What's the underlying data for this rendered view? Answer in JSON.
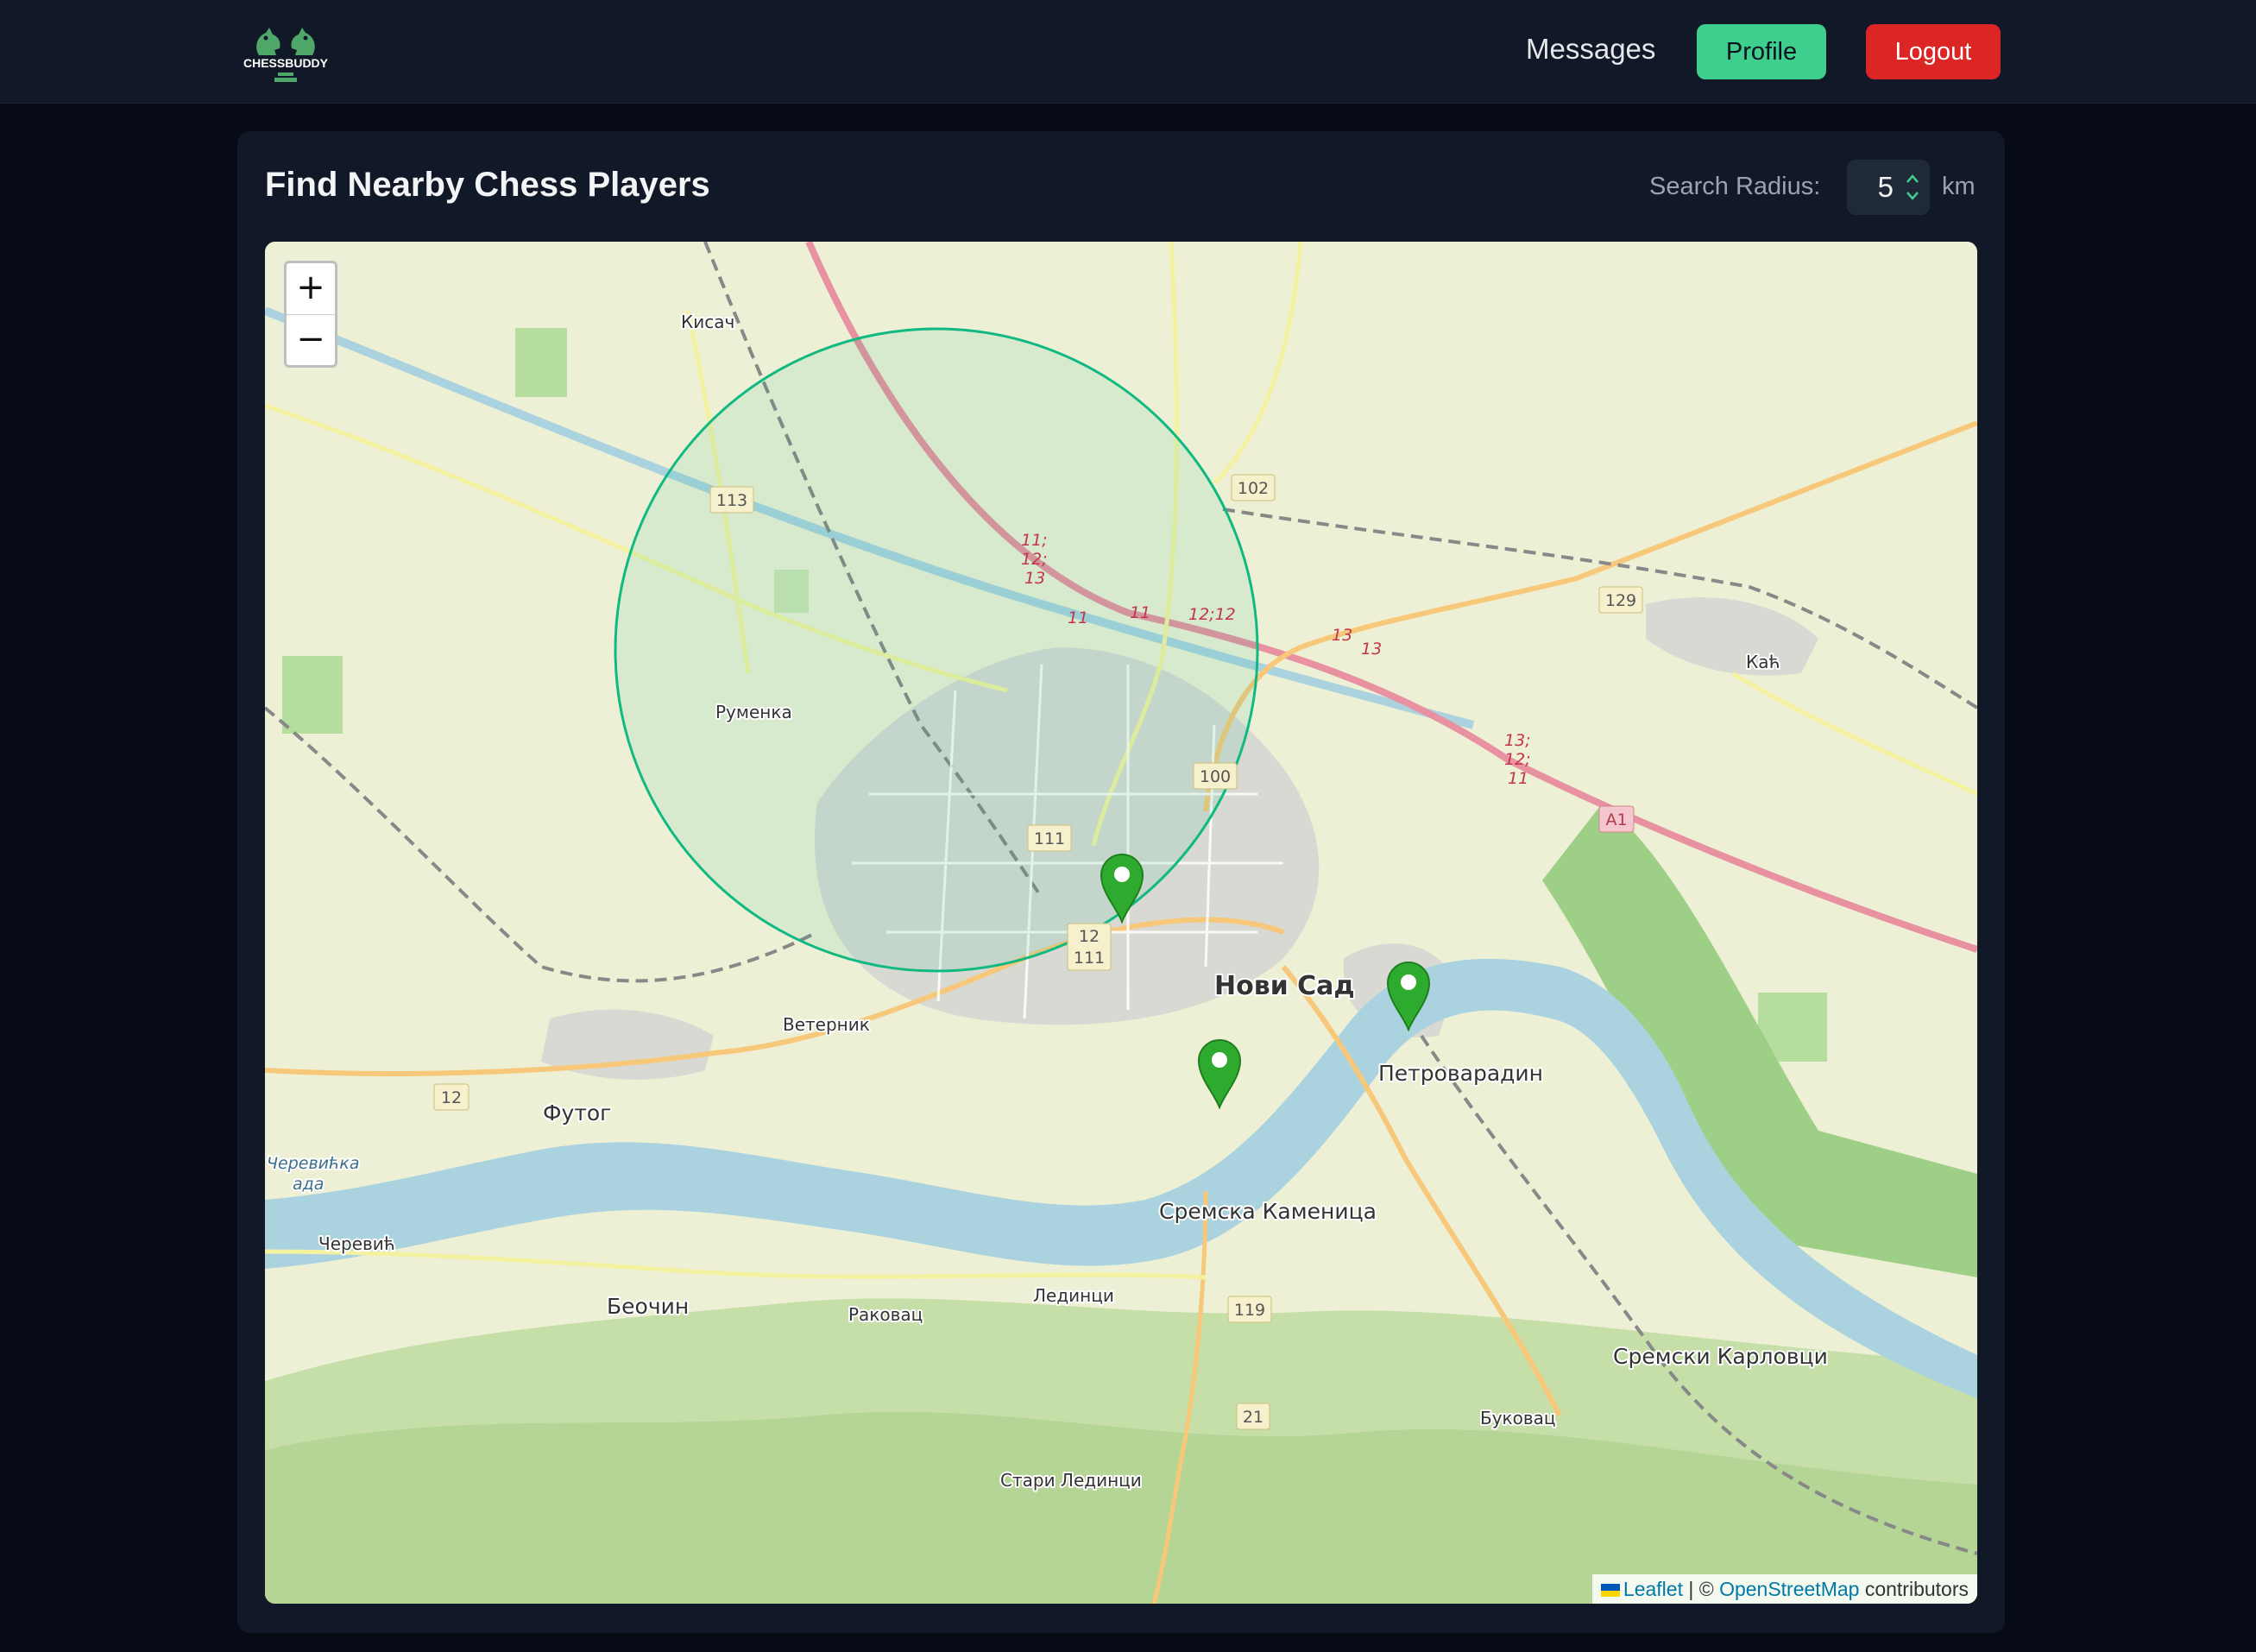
{
  "app": {
    "logo_text": "CHESSBUDDY",
    "brand_color": "#3ecf8e"
  },
  "nav": {
    "messages_label": "Messages",
    "profile_label": "Profile",
    "logout_label": "Logout",
    "logout_color": "#dc2626"
  },
  "page": {
    "title": "Find Nearby Chess Players",
    "radius_label": "Search Radius:",
    "radius_value": "5",
    "radius_unit": "km"
  },
  "map": {
    "zoom_in_label": "+",
    "zoom_out_label": "−",
    "circle_color": "#10b981",
    "marker_color": "#2eaa2e",
    "marker_count": 3,
    "place_labels": {
      "kisac": "Кисач",
      "rumenka": "Руменка",
      "kac": "Каћ",
      "veternik": "Ветерник",
      "novi_sad": "Нови Сад",
      "petrovaradin": "Петроварадин",
      "futog": "Футог",
      "cerevicka_ada_1": "Черевићка",
      "cerevicka_ada_2": "ада",
      "cerevic": "Черевић",
      "beocin": "Беочин",
      "rakovac": "Раковац",
      "ledinci": "Лединци",
      "sremska_kamenica": "Сремска Каменица",
      "sremski_karlovci": "Сремски Карловци",
      "bukovac": "Буковац",
      "stari_ledinci": "Стари Лединци"
    },
    "road_shields": {
      "r113": "113",
      "r102": "102",
      "r129": "129",
      "r100": "100",
      "r111": "111",
      "r12": "12",
      "r12b": "12",
      "r111b": "111",
      "r119": "119",
      "r21": "21",
      "a1": "A1"
    },
    "motorway_refs": {
      "m1": "11;",
      "m2": "12;",
      "m3": "13",
      "m4": "11",
      "m5": "11",
      "m6": "12;12",
      "m7": "13",
      "m8": "13",
      "m9": "13;",
      "m10": "12;",
      "m11": "11"
    },
    "attribution": {
      "leaflet": "Leaflet",
      "separator": " | © ",
      "osm": "OpenStreetMap",
      "suffix": " contributors"
    }
  }
}
